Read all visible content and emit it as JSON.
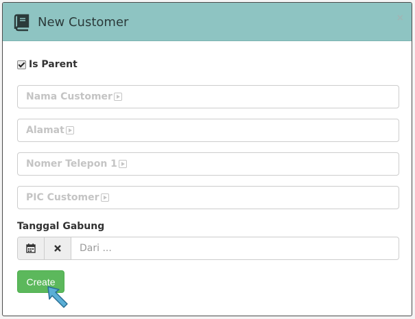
{
  "modal": {
    "title": "New Customer",
    "close_label": "×"
  },
  "form": {
    "is_parent_label": "Is Parent",
    "is_parent_checked": true,
    "fields": [
      {
        "placeholder": "Nama Customer"
      },
      {
        "placeholder": "Alamat"
      },
      {
        "placeholder": "Nomer Telepon 1"
      },
      {
        "placeholder": "PIC Customer"
      }
    ],
    "date_section_label": "Tanggal Gabung",
    "date_placeholder": "Dari  ...",
    "create_label": "Create"
  },
  "icons": {
    "header": "book-icon",
    "calendar": "calendar-icon",
    "clear": "clear-x-icon",
    "field_hint": "play-hint-icon",
    "cursor": "arrow-pointer-icon"
  },
  "colors": {
    "header_bg": "#8ec4c2",
    "button_bg": "#5cb85c",
    "pointer": "#5aaed6"
  }
}
